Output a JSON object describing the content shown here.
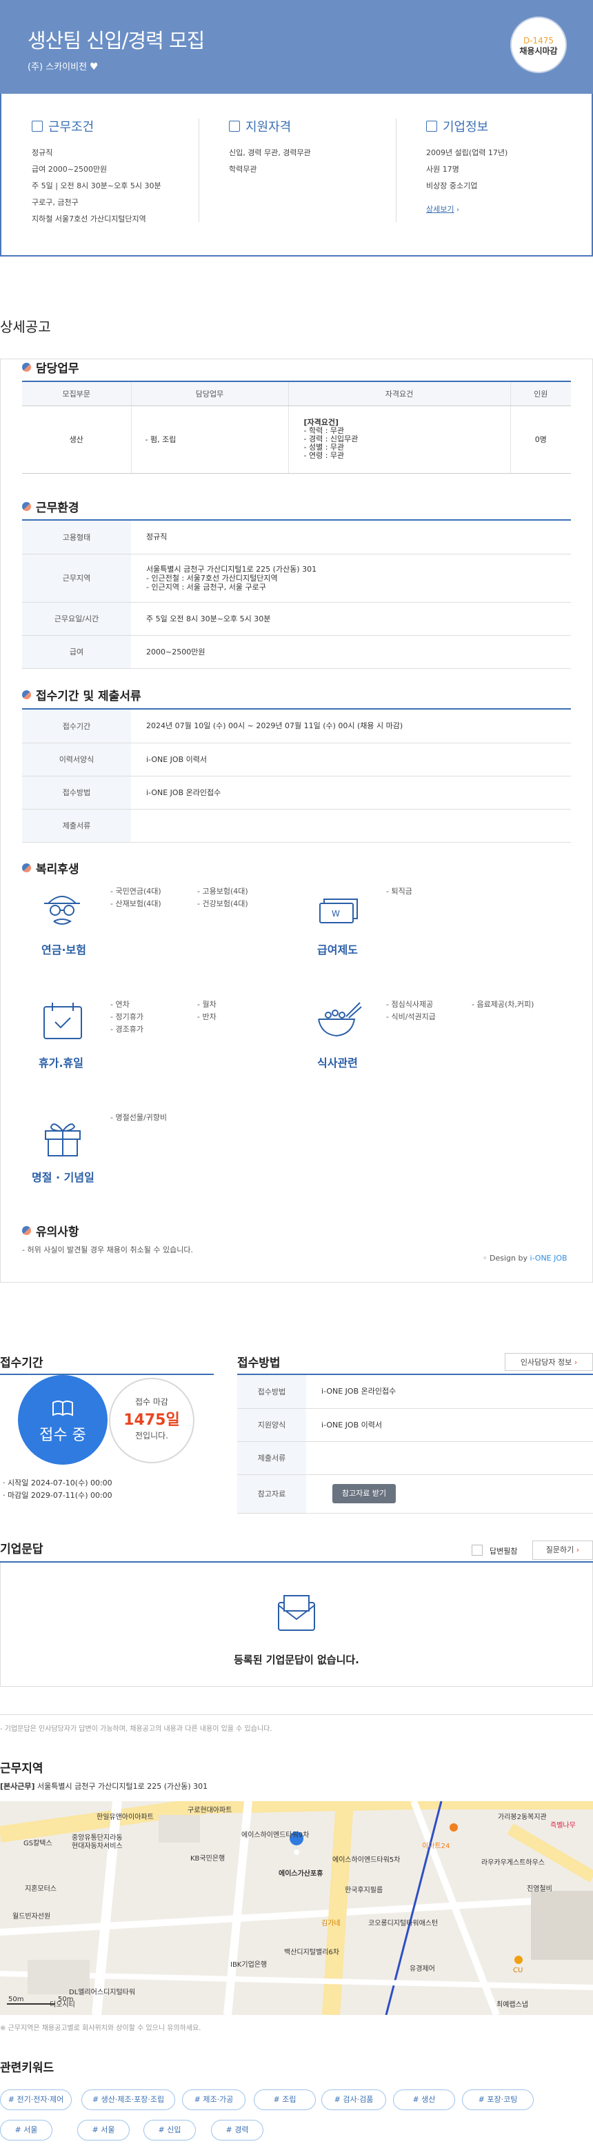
{
  "header": {
    "title": "생산팀 신입/경력 모집",
    "company": "(주) 스카이비전",
    "dday": "D-1475",
    "dday_status": "채용시마감"
  },
  "summary": {
    "conditions": {
      "title": "근무조건",
      "items": [
        "정규직",
        "급여 2000~2500만원",
        "주 5일 | 오전 8시 30분~오후 5시 30분",
        "구로구, 금천구",
        "지하철 서울7호선 가산디지털단지역"
      ]
    },
    "qualification": {
      "title": "지원자격",
      "items": [
        "신입, 경력 무관, 경력무관",
        "학력무관"
      ]
    },
    "company": {
      "title": "기업정보",
      "items": [
        "2009년 설립(업력 17년)",
        "사원 17명",
        "비상장 중소기업"
      ],
      "link": "상세보기"
    }
  },
  "detail_title": "상세공고",
  "duty": {
    "title": "담당업무",
    "headers": [
      "모집부문",
      "담당업무",
      "자격요건",
      "인원"
    ],
    "row": {
      "part": "생산",
      "task": "- 펌, 조립",
      "req_title": "[자격요건]",
      "req": [
        "- 학력 : 무관",
        "- 경력 : 신입무관",
        "- 성별 : 무관",
        "- 연령 : 무관"
      ],
      "count": "0명"
    }
  },
  "env": {
    "title": "근무환경",
    "rows": [
      {
        "k": "고용형태",
        "v": [
          "정규직"
        ]
      },
      {
        "k": "근무지역",
        "v": [
          "서울특별시 금천구 가산디지털1로 225 (가산동) 301",
          "- 인근전철 : 서울7호선 가산디지털단지역",
          "- 인근지역 : 서울 금천구, 서울 구로구"
        ]
      },
      {
        "k": "근무요일/시간",
        "v": [
          "주 5일 오전 8시 30분~오후 5시 30분"
        ]
      },
      {
        "k": "급여",
        "v": [
          "2000~2500만원"
        ]
      }
    ]
  },
  "apply": {
    "title": "접수기간 및 제출서류",
    "rows": [
      {
        "k": "접수기간",
        "v": "2024년 07월 10일 (수) 00시 ~ 2029년 07월 11일 (수) 00시 (채용 시 마감)"
      },
      {
        "k": "이력서양식",
        "v": "i-ONE JOB 이력서"
      },
      {
        "k": "접수방법",
        "v": "i-ONE JOB 온라인접수"
      },
      {
        "k": "제출서류",
        "v": ""
      }
    ]
  },
  "welfare": {
    "title": "복리후생",
    "pension": {
      "label": "연금·보험",
      "c1": [
        "- 국민연금(4대)",
        "- 산재보험(4대)"
      ],
      "c2": [
        "- 고용보험(4대)",
        "- 건강보험(4대)"
      ]
    },
    "salary": {
      "label": "급여제도",
      "c1": [
        "- 퇴직금"
      ]
    },
    "vacation": {
      "label": "휴가.휴일",
      "c1": [
        "- 연차",
        "- 정기휴가",
        "- 경조휴가"
      ],
      "c2": [
        "- 월차",
        "- 반차"
      ]
    },
    "meal": {
      "label": "식사관련",
      "c1": [
        "- 점심식사제공",
        "- 식비/석권지급"
      ],
      "c2": [
        "- 음료제공(차,커피)"
      ]
    },
    "holiday": {
      "label": "명절 · 기념일",
      "c1": [
        "- 명절선물/귀향비"
      ]
    }
  },
  "notice": {
    "title": "유의사항",
    "text": "- 허위 사실이 발견될 경우 채용이 취소될 수 있습니다.",
    "design_pre": "◦ Design by ",
    "design_brand": "i-ONE JOB"
  },
  "period": {
    "title": "접수기간",
    "status": "접수 중",
    "deadline_pre": "접수 마감",
    "days": "1475일",
    "deadline_post": "전입니다.",
    "start": "시작일 2024-07-10(수) 00:00",
    "end": "마감일 2029-07-11(수) 00:00"
  },
  "method": {
    "title": "접수방법",
    "hr_btn": "인사담당자 정보",
    "rows": [
      {
        "k": "접수방법",
        "v": "i-ONE JOB 온라인접수"
      },
      {
        "k": "지원양식",
        "v": "i-ONE JOB 이력서"
      },
      {
        "k": "제출서류",
        "v": ""
      },
      {
        "k": "참고자료",
        "v": ""
      }
    ],
    "ref_btn": "참고자료 받기"
  },
  "qna": {
    "title": "기업문답",
    "check": "답변필참",
    "ask_btn": "질문하기",
    "empty": "등록된 기업문답이 없습니다.",
    "note": "- 기업문답은 인사담당자가 답변이 가능하며, 채용공고의 내용과 다른 내용이 있을 수 있습니다."
  },
  "location": {
    "title": "근무지역",
    "addr_tag": "[본사근무]",
    "addr": "서울특별시 금천구 가산디지털1로 225 (가산동) 301",
    "note": "※ 근무지역은 채용공고별로 회사위치와 상이할 수 있으니 유의하세요.",
    "scale1": "50m",
    "scale2": "50m",
    "labels": [
      "구로현대아파트",
      "한일유앤아이아파트",
      "중앙유통단지라동",
      "현대자동차서비스",
      "에이스하이엔드타워9차",
      "KB국민은행",
      "에이스가산포휴",
      "에이스하이엔드타워5차",
      "한국후지필름",
      "GS칼텍스",
      "지혼모터스",
      "월드빈자선원",
      "이마트24",
      "가리봉2동복지관",
      "즉벨나무",
      "라우카우게스트하우스",
      "진영철비",
      "CU",
      "코오롱디지털타워애스턴",
      "유경제어",
      "최예랩스냅",
      "IBK기업은행",
      "백산디지털밸리6차",
      "김가네",
      "DL엘리어스디지털타워",
      "디오시티"
    ]
  },
  "keywords": {
    "title": "관련키워드",
    "items": [
      "# 전기·전자·제어",
      "# 생산·제조·포장·조립",
      "# 제조·가공",
      "# 조립",
      "# 검사·검품",
      "# 생산",
      "# 포장·코팅",
      "# 서울",
      "# 서울",
      "# 신입",
      "# 경력"
    ]
  },
  "colors": {
    "header": "#6b8fc5",
    "accent": "#3a6fb4",
    "status_blue": "#2f7be0",
    "deadline_red": "#e8451e"
  }
}
